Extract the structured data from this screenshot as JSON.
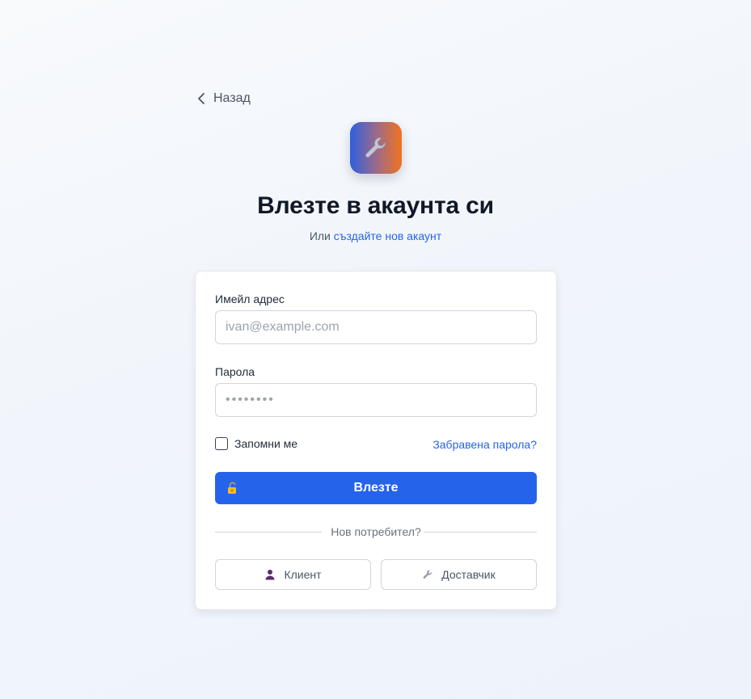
{
  "nav": {
    "back_label": "Назад"
  },
  "header": {
    "title": "Влезте в акаунта си",
    "subtitle_prefix": "Или",
    "subtitle_link": "създайте нов акаунт"
  },
  "form": {
    "email_label": "Имейл адрес",
    "email_placeholder": "ivan@example.com",
    "password_label": "Парола",
    "password_placeholder": "••••••••",
    "remember_label": "Запомни ме",
    "remember_checked": false,
    "forgot_label": "Забравена парола?",
    "submit_label": "Влезте"
  },
  "signup": {
    "divider_label": "Нов потребител?",
    "client_label": "Клиент",
    "supplier_label": "Доставчик"
  },
  "colors": {
    "primary": "#2563eb",
    "logo_gradient_start": "#2f5fe0",
    "logo_gradient_end": "#f0731f"
  },
  "icons": {
    "back": "chevron-left-icon",
    "logo": "wrench-icon",
    "submit": "unlocked-padlock-icon",
    "client": "person-icon",
    "supplier": "wrench-icon"
  }
}
